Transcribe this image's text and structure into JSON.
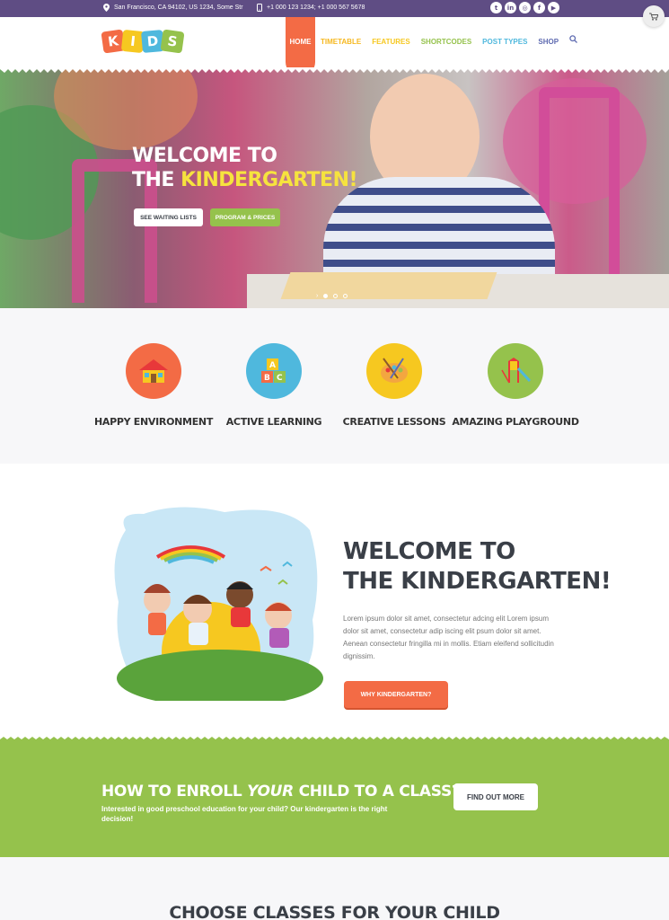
{
  "topbar": {
    "address": "San Francisco, CA 94102, US 1234, Some Str",
    "phones": "+1 000 123 1234; +1 000 567 5678",
    "social_icons": [
      "twitter-icon",
      "linkedin-icon",
      "instagram-icon",
      "facebook-icon",
      "youtube-icon"
    ],
    "cart_icon": "cart-icon"
  },
  "header": {
    "logo_letters": [
      "K",
      "I",
      "D",
      "S"
    ],
    "logo_colors": [
      "#f36b45",
      "#f6c820",
      "#4fb8dd",
      "#95c24c"
    ],
    "nav": [
      {
        "label": "HOME",
        "color": "#ffffff",
        "active": true
      },
      {
        "label": "TIMETABLE",
        "color": "#f6b820"
      },
      {
        "label": "FEATURES",
        "color": "#f6c820"
      },
      {
        "label": "SHORTCODES",
        "color": "#95c24c"
      },
      {
        "label": "POST TYPES",
        "color": "#4fb8dd"
      },
      {
        "label": "SHOP",
        "color": "#5f6bb1"
      }
    ]
  },
  "hero": {
    "title_line1": "WELCOME TO",
    "title_line2_pre": "THE",
    "title_line2_highlight": "KINDERGARTEN!",
    "btn_primary": "SEE WAITING LISTS",
    "btn_secondary": "PROGRAM & PRICES"
  },
  "features": [
    {
      "label": "HAPPY ENVIRONMENT",
      "color": "#f36b45",
      "icon": "house-icon"
    },
    {
      "label": "ACTIVE LEARNING",
      "color": "#4fb8dd",
      "icon": "blocks-icon"
    },
    {
      "label": "CREATIVE LESSONS",
      "color": "#f6c820",
      "icon": "palette-icon"
    },
    {
      "label": "AMAZING PLAYGROUND",
      "color": "#95c24c",
      "icon": "slide-icon"
    }
  ],
  "welcome": {
    "title_line1": "WELCOME TO",
    "title_line2": "THE KINDERGARTEN!",
    "text": "Lorem ipsum dolor sit amet, consectetur adcing elit Lorem ipsum dolor sit amet, consectetur adip iscing elit psum dolor sit amet. Aenean consectetur fringilla mi in mollis. Etiam eleifend sollicitudin dignissim.",
    "button": "WHY KINDERGARTEN?"
  },
  "enroll": {
    "title_pre": "HOW TO ENROLL ",
    "title_em": "YOUR",
    "title_post": " CHILD TO A CLASS?",
    "subtitle": "Interested in good preschool education for your child? Our kindergarten is the right decision!",
    "button": "FIND OUT MORE"
  },
  "classes": {
    "title": "CHOOSE CLASSES FOR YOUR CHILD"
  }
}
